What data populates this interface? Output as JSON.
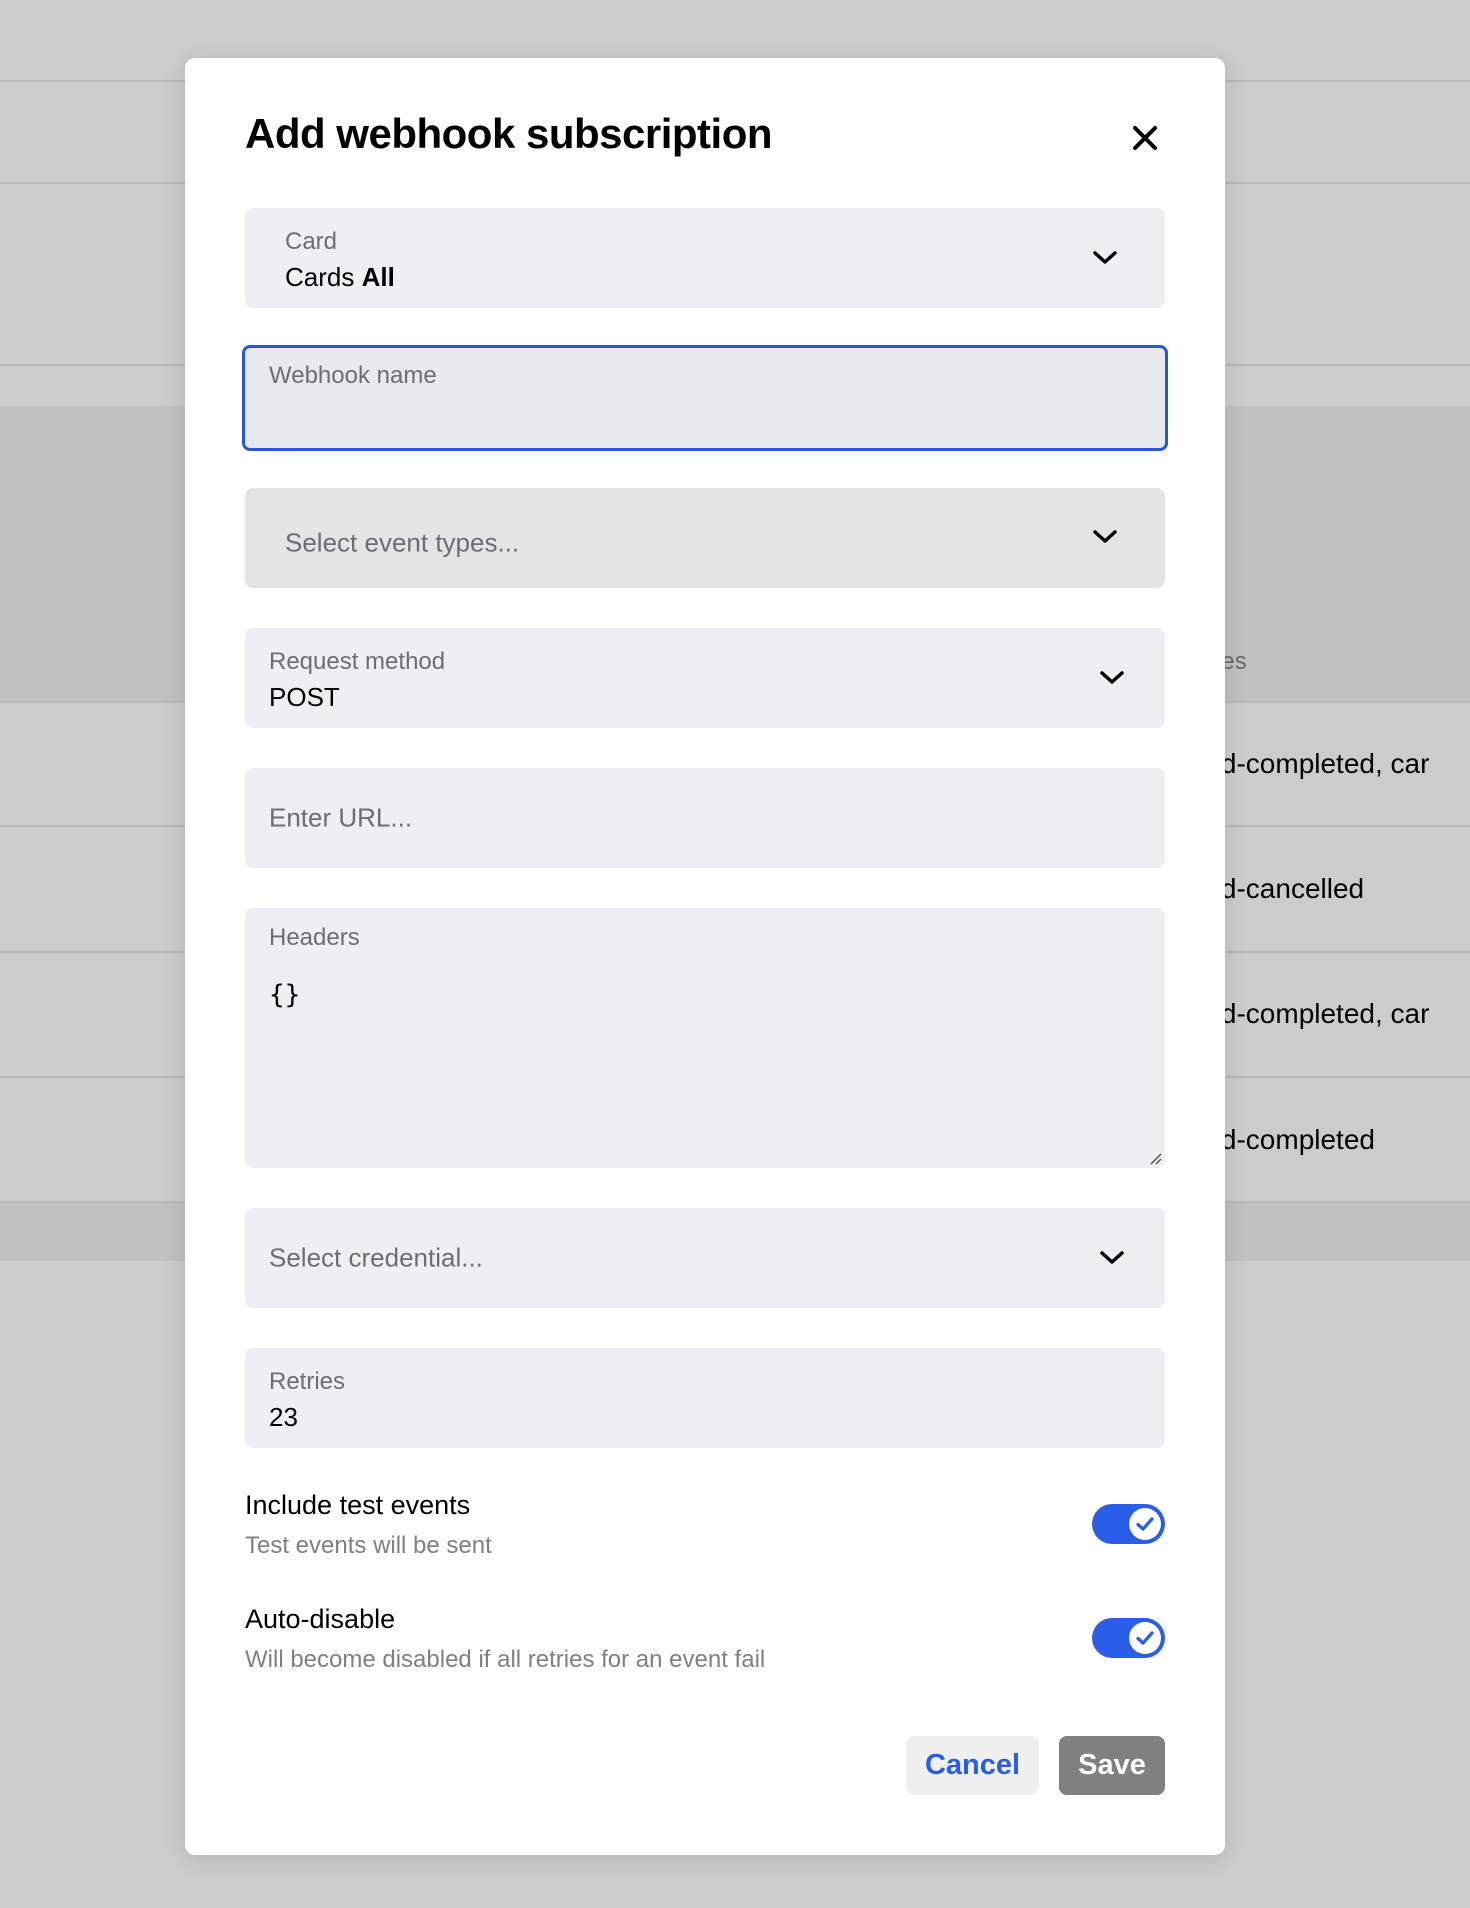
{
  "background": {
    "table": {
      "header_partial": "ypes",
      "rows_partial": [
        "ard-completed, car",
        "ard-cancelled",
        "ard-completed, car",
        "ard-completed"
      ]
    }
  },
  "modal": {
    "title": "Add webhook subscription",
    "close_icon": "close-icon",
    "card_select": {
      "label": "Card",
      "value_prefix": "Cards",
      "value_bold": "All"
    },
    "webhook_name": {
      "label": "Webhook name",
      "value": ""
    },
    "event_types": {
      "placeholder": "Select event types..."
    },
    "request_method": {
      "label": "Request method",
      "value": "POST"
    },
    "url": {
      "placeholder": "Enter URL..."
    },
    "headers": {
      "label": "Headers",
      "value": "{}"
    },
    "credential": {
      "placeholder": "Select credential..."
    },
    "retries": {
      "label": "Retries",
      "value": "23"
    },
    "toggles": [
      {
        "title": "Include test events",
        "description": "Test events will be sent",
        "on": true
      },
      {
        "title": "Auto-disable",
        "description": "Will become disabled if all retries for an event fail",
        "on": true
      }
    ],
    "buttons": {
      "cancel": "Cancel",
      "save": "Save"
    }
  },
  "colors": {
    "accent": "#2a5ee8",
    "focus_border": "#2756d6",
    "save_disabled": "#808080",
    "overlay_bg": "#cccccc"
  }
}
